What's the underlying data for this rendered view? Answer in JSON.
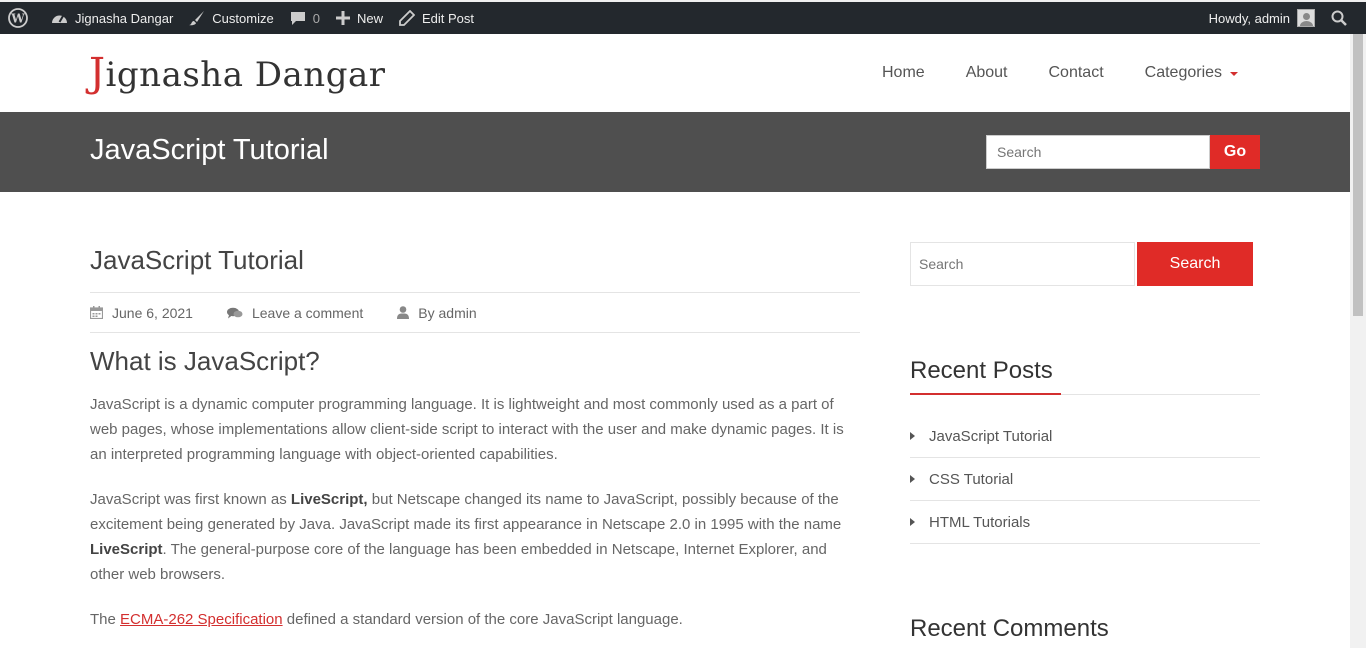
{
  "adminbar": {
    "site_name": "Jignasha Dangar",
    "customize": "Customize",
    "comments_count": "0",
    "new": "New",
    "edit_post": "Edit Post",
    "howdy": "Howdy, admin"
  },
  "header": {
    "logo_first": "J",
    "logo_rest": "ignasha Dangar",
    "nav": [
      "Home",
      "About",
      "Contact",
      "Categories"
    ]
  },
  "banner": {
    "title": "JavaScript Tutorial",
    "search_placeholder": "Search",
    "go_label": "Go"
  },
  "post": {
    "title": "JavaScript Tutorial",
    "date": "June 6, 2021",
    "comment_link": "Leave a comment",
    "author": "By admin",
    "heading": "What is JavaScript?",
    "p1": "JavaScript is a dynamic computer programming language. It is lightweight and most commonly used as a part of web pages, whose implementations allow client-side script to interact with the user and make dynamic pages. It is an interpreted programming language with object-oriented capabilities.",
    "p2_a": "JavaScript was first known as ",
    "p2_b": "LiveScript,",
    "p2_c": " but Netscape changed its name to JavaScript, possibly because of the excitement being generated by Java. JavaScript made its first appearance in Netscape 2.0 in 1995 with the name ",
    "p2_d": "LiveScript",
    "p2_e": ". The general-purpose core of the language has been embedded in Netscape, Internet Explorer, and other web browsers.",
    "p3_a": "The ",
    "p3_link": "ECMA-262 Specification",
    "p3_b": " defined a standard version of the core JavaScript language."
  },
  "sidebar": {
    "search_placeholder": "Search",
    "search_button": "Search",
    "recent_posts_title": "Recent Posts",
    "recent_posts": [
      "JavaScript Tutorial",
      "CSS Tutorial",
      "HTML Tutorials"
    ],
    "recent_comments_title": "Recent Comments"
  },
  "colors": {
    "accent": "#e02b27",
    "adminbar": "#23282d",
    "banner": "#4f4f4f"
  }
}
